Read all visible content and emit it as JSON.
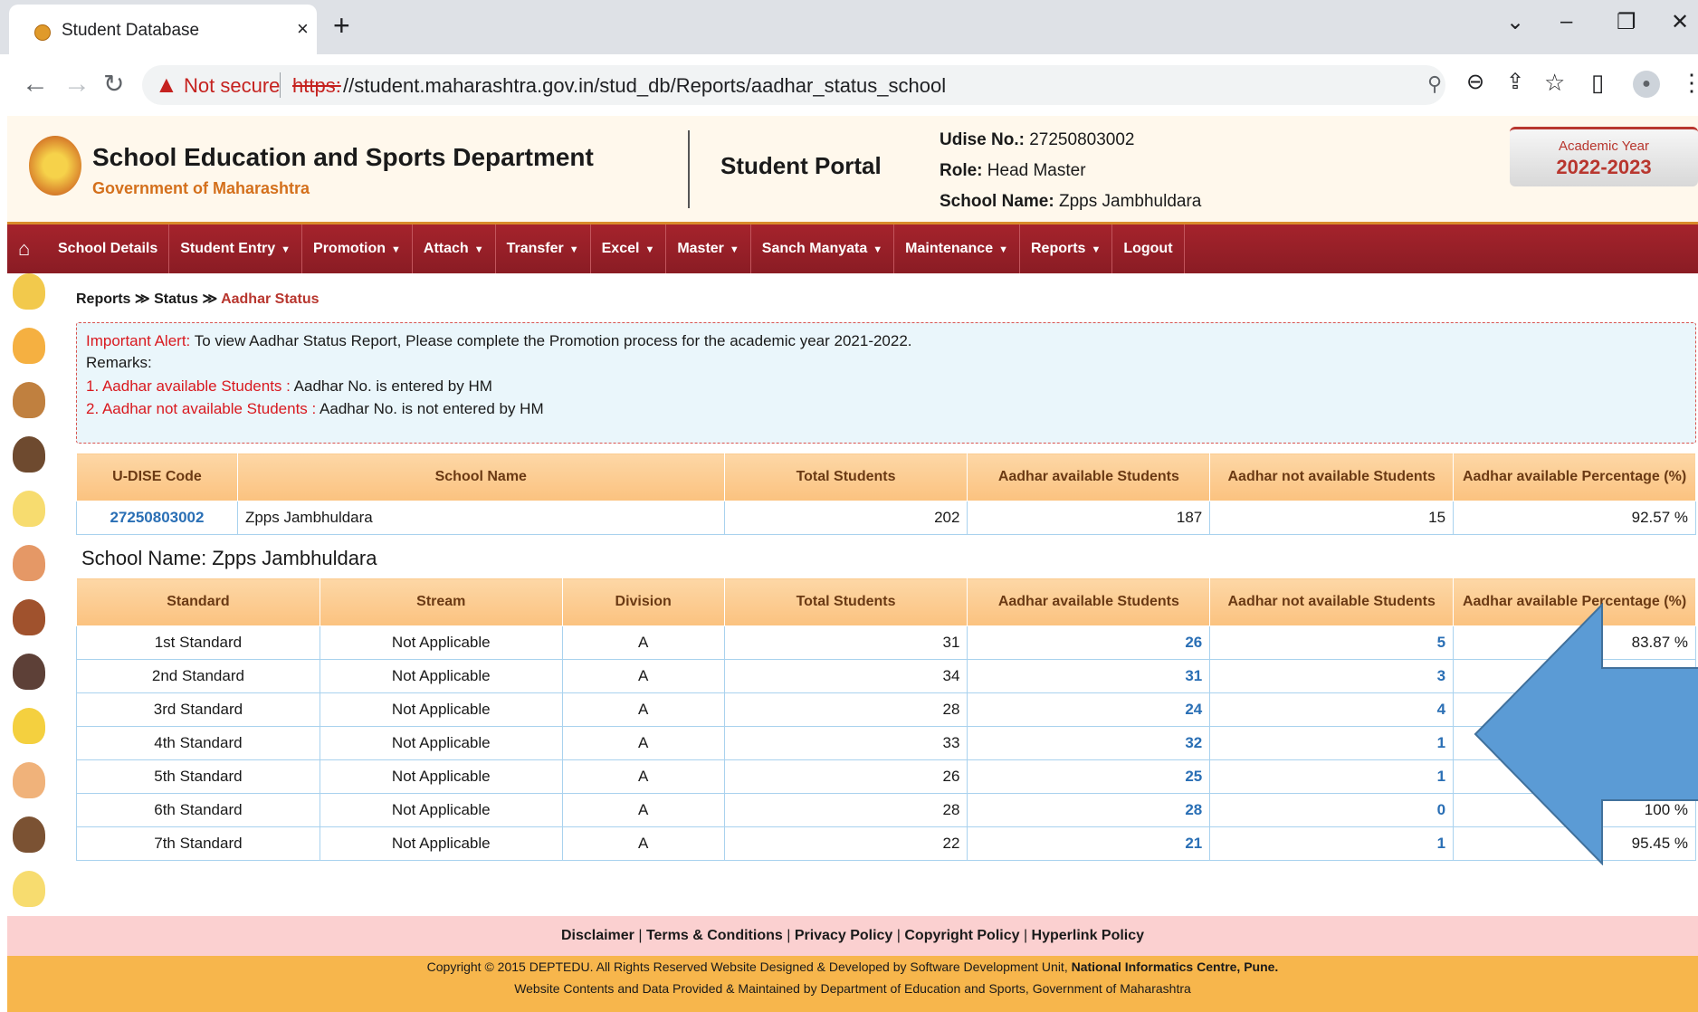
{
  "browser": {
    "tab_title": "Student Database",
    "tab_close": "×",
    "new_tab": "+",
    "not_secure": "Not secure",
    "url_protocol": "https:",
    "url_rest": "//student.maharashtra.gov.in/stud_db/Reports/aadhar_status_school"
  },
  "header": {
    "title": "School Education and Sports Department",
    "subtitle": "Government of Maharashtra",
    "portal": "Student Portal",
    "udise_label": "Udise No.:",
    "udise_value": "27250803002",
    "role_label": "Role:",
    "role_value": "Head Master",
    "school_label": "School Name:",
    "school_value": "Zpps Jambhuldara",
    "academic_label": "Academic Year",
    "academic_value": "2022-2023"
  },
  "menu": [
    {
      "label": "School Details",
      "dropdown": false
    },
    {
      "label": "Student Entry",
      "dropdown": true
    },
    {
      "label": "Promotion",
      "dropdown": true
    },
    {
      "label": "Attach",
      "dropdown": true
    },
    {
      "label": "Transfer",
      "dropdown": true
    },
    {
      "label": "Excel",
      "dropdown": true
    },
    {
      "label": "Master",
      "dropdown": true
    },
    {
      "label": "Sanch Manyata",
      "dropdown": true
    },
    {
      "label": "Maintenance",
      "dropdown": true
    },
    {
      "label": "Reports",
      "dropdown": true
    },
    {
      "label": "Logout",
      "dropdown": false
    }
  ],
  "breadcrumb": {
    "items": [
      "Reports",
      "Status"
    ],
    "separator": "≫",
    "current": "Aadhar Status"
  },
  "alert": {
    "title": "Important Alert:",
    "message": " To view Aadhar Status Report, Please complete the Promotion process for the academic year 2021-2022.",
    "remarks": "Remarks:",
    "remark1_label": "1. Aadhar available Students :",
    "remark1_text": " Aadhar No. is entered by HM",
    "remark2_label": "2. Aadhar not available Students :",
    "remark2_text": " Aadhar No. is not entered by HM"
  },
  "summary": {
    "headers": [
      "U-DISE Code",
      "School Name",
      "Total Students",
      "Aadhar available Students",
      "Aadhar not available Students",
      "Aadhar available Percentage (%)"
    ],
    "row": {
      "code": "27250803002",
      "name": "Zpps Jambhuldara",
      "total": "202",
      "available": "187",
      "not_available": "15",
      "percent": "92.57 %"
    }
  },
  "school_heading": "School Name: Zpps Jambhuldara",
  "detail": {
    "headers": [
      "Standard",
      "Stream",
      "Division",
      "Total Students",
      "Aadhar available Students",
      "Aadhar not available Students",
      "Aadhar available Percentage (%)"
    ],
    "rows": [
      {
        "standard": "1st Standard",
        "stream": "Not Applicable",
        "division": "A",
        "total": "31",
        "available": "26",
        "not_available": "5",
        "percent": "83.87 %"
      },
      {
        "standard": "2nd Standard",
        "stream": "Not Applicable",
        "division": "A",
        "total": "34",
        "available": "31",
        "not_available": "3",
        "percent": ""
      },
      {
        "standard": "3rd Standard",
        "stream": "Not Applicable",
        "division": "A",
        "total": "28",
        "available": "24",
        "not_available": "4",
        "percent": ""
      },
      {
        "standard": "4th Standard",
        "stream": "Not Applicable",
        "division": "A",
        "total": "33",
        "available": "32",
        "not_available": "1",
        "percent": ""
      },
      {
        "standard": "5th Standard",
        "stream": "Not Applicable",
        "division": "A",
        "total": "26",
        "available": "25",
        "not_available": "1",
        "percent": ""
      },
      {
        "standard": "6th Standard",
        "stream": "Not Applicable",
        "division": "A",
        "total": "28",
        "available": "28",
        "not_available": "0",
        "percent": "100 %"
      },
      {
        "standard": "7th Standard",
        "stream": "Not Applicable",
        "division": "A",
        "total": "22",
        "available": "21",
        "not_available": "1",
        "percent": "95.45 %"
      }
    ]
  },
  "footer": {
    "links": [
      "Disclaimer",
      "Terms & Conditions",
      "Privacy Policy",
      "Copyright Policy",
      "Hyperlink Policy"
    ],
    "copyright_prefix": "Copyright © 2015 DEPTEDU. All Rights Reserved Website Designed & Developed by Software Development Unit,",
    "copyright_org": " National Informatics Centre, Pune.",
    "maintained": "Website Contents and Data Provided & Maintained by Department of Education and Sports, Government of Maharashtra"
  },
  "colors": {
    "menu_red": "#a5232c",
    "link_blue": "#2a6fb5",
    "header_orange": "#fbc27f",
    "arrow_blue": "#5b9bd5"
  }
}
